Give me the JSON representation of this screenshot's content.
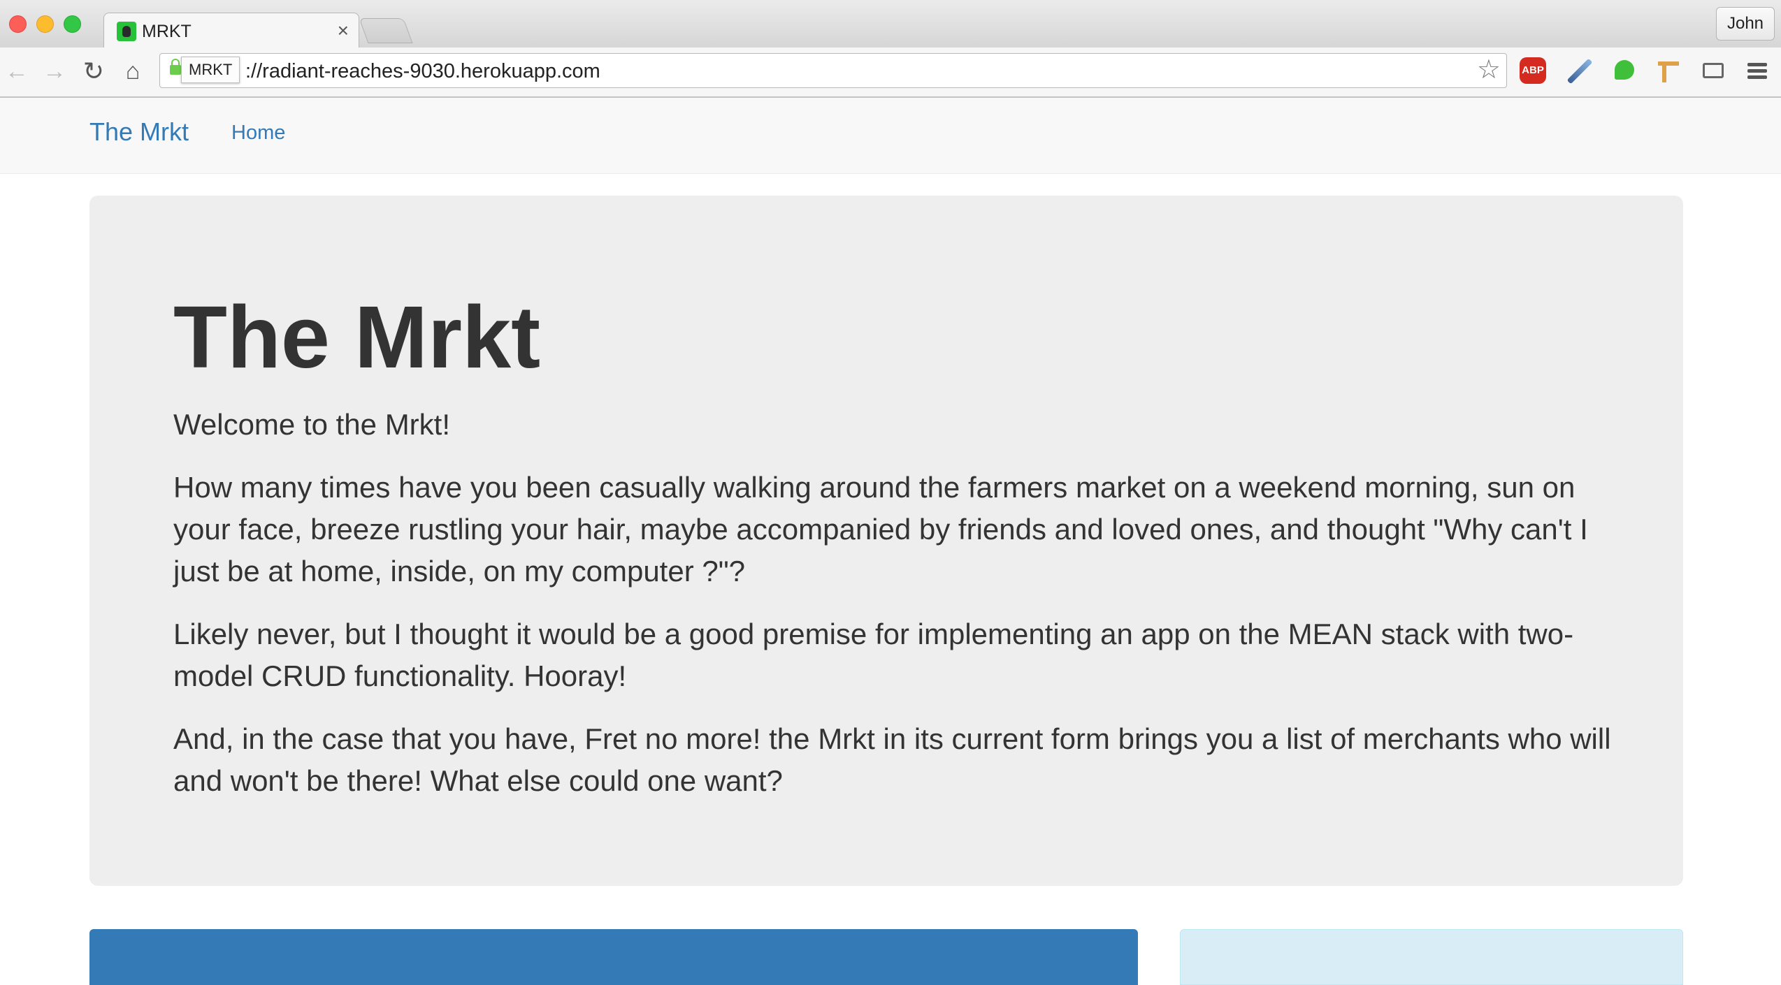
{
  "browser": {
    "tab_title": "MRKT",
    "tab_close": "×",
    "profile_name": "John",
    "tooltip": "MRKT",
    "url": "://radiant-reaches-9030.herokuapp.com",
    "extensions": {
      "abp_label": "ABP"
    },
    "icons": {
      "back": "arrow-left",
      "forward": "arrow-right",
      "reload": "reload",
      "home": "home",
      "bookmark": "star-outline",
      "menu": "hamburger"
    }
  },
  "navbar": {
    "brand": "The Mrkt",
    "links": [
      "Home"
    ]
  },
  "jumbotron": {
    "title": "The Mrkt",
    "welcome": "Welcome to the Mrkt!",
    "paragraphs": [
      "How many times have you been casually walking around the farmers market on a weekend morning, sun on your face, breeze rustling your hair, maybe accompanied by friends and loved ones, and thought \"Why can't I just be at home, inside, on my computer ?\"?",
      "Likely never, but I thought it would be a good premise for implementing an app on the MEAN stack with two-model CRUD functionality. Hooray!",
      "And, in the case that you have, Fret no more! the Mrkt in its current form brings you a list of merchants who will and won't be there! What else could one want?"
    ]
  },
  "colors": {
    "link": "#337ab7",
    "jumbotron_bg": "#eeeeee",
    "panel_primary": "#337ab7",
    "panel_info": "#d9edf7"
  }
}
